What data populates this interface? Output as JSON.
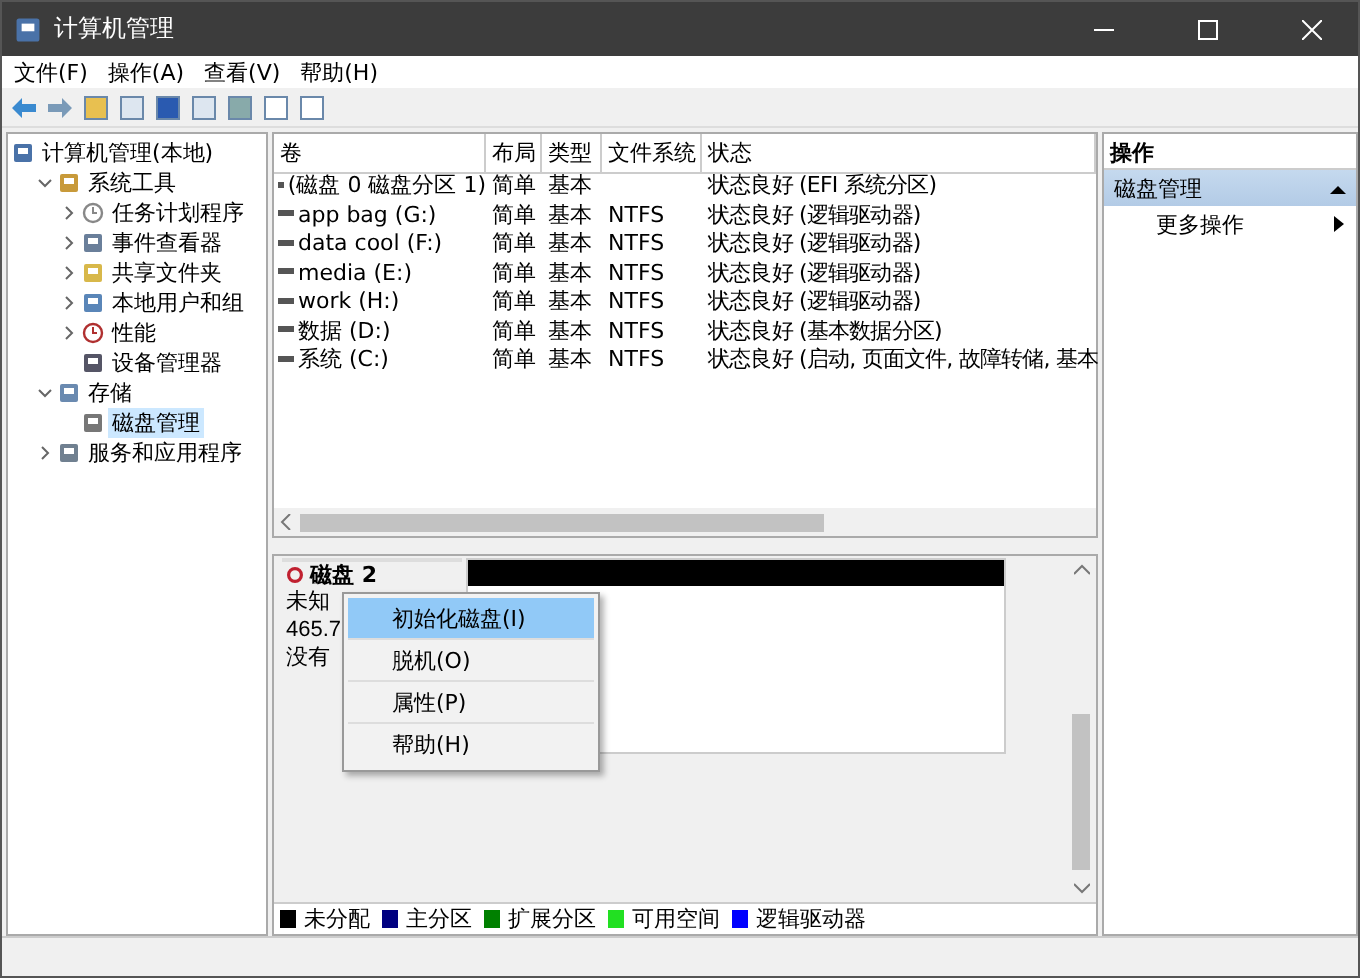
{
  "window": {
    "title": "计算机管理"
  },
  "menu": [
    "文件(F)",
    "操作(A)",
    "查看(V)",
    "帮助(H)"
  ],
  "tree": [
    {
      "label": "计算机管理(本地)",
      "selected": false,
      "children": [
        {
          "label": "系统工具",
          "expanded": true,
          "selected": false,
          "children": [
            {
              "label": "任务计划程序",
              "expanded": false,
              "selected": false
            },
            {
              "label": "事件查看器",
              "expanded": false,
              "selected": false
            },
            {
              "label": "共享文件夹",
              "expanded": false,
              "selected": false
            },
            {
              "label": "本地用户和组",
              "expanded": false,
              "selected": false
            },
            {
              "label": "性能",
              "expanded": false,
              "selected": false
            },
            {
              "label": "设备管理器",
              "selected": false
            }
          ]
        },
        {
          "label": "存储",
          "expanded": true,
          "selected": false,
          "children": [
            {
              "label": "磁盘管理",
              "selected": true
            }
          ]
        },
        {
          "label": "服务和应用程序",
          "expanded": false,
          "selected": false
        }
      ]
    }
  ],
  "table": {
    "columns": [
      "卷",
      "布局",
      "类型",
      "文件系统",
      "状态"
    ],
    "rows": [
      [
        "(磁盘 0 磁盘分区 1)",
        "简单",
        "基本",
        "",
        "状态良好 (EFI 系统分区)"
      ],
      [
        "app bag (G:)",
        "简单",
        "基本",
        "NTFS",
        "状态良好 (逻辑驱动器)"
      ],
      [
        "data cool (F:)",
        "简单",
        "基本",
        "NTFS",
        "状态良好 (逻辑驱动器)"
      ],
      [
        "media (E:)",
        "简单",
        "基本",
        "NTFS",
        "状态良好 (逻辑驱动器)"
      ],
      [
        "work (H:)",
        "简单",
        "基本",
        "NTFS",
        "状态良好 (逻辑驱动器)"
      ],
      [
        "数据 (D:)",
        "简单",
        "基本",
        "NTFS",
        "状态良好 (基本数据分区)"
      ],
      [
        "系统 (C:)",
        "简单",
        "基本",
        "NTFS",
        "状态良好 (启动, 页面文件, 故障转储, 基本"
      ]
    ]
  },
  "disk": {
    "name": "磁盘 2",
    "lines": [
      "未知",
      "465.7",
      "没有"
    ]
  },
  "context_menu": [
    {
      "label": "初始化磁盘(I)",
      "selected": true
    },
    {
      "label": "脱机(O)",
      "selected": false
    },
    {
      "label": "属性(P)",
      "selected": false
    },
    {
      "label": "帮助(H)",
      "selected": false
    }
  ],
  "legend": [
    {
      "label": "未分配",
      "color": "#000000"
    },
    {
      "label": "主分区",
      "color": "#000080"
    },
    {
      "label": "扩展分区",
      "color": "#008000"
    },
    {
      "label": "可用空间",
      "color": "#22e022"
    },
    {
      "label": "逻辑驱动器",
      "color": "#0000ff"
    }
  ],
  "actions": {
    "header": "操作",
    "section": {
      "label": "磁盘管理",
      "expanded": true
    },
    "items": [
      "更多操作"
    ]
  }
}
